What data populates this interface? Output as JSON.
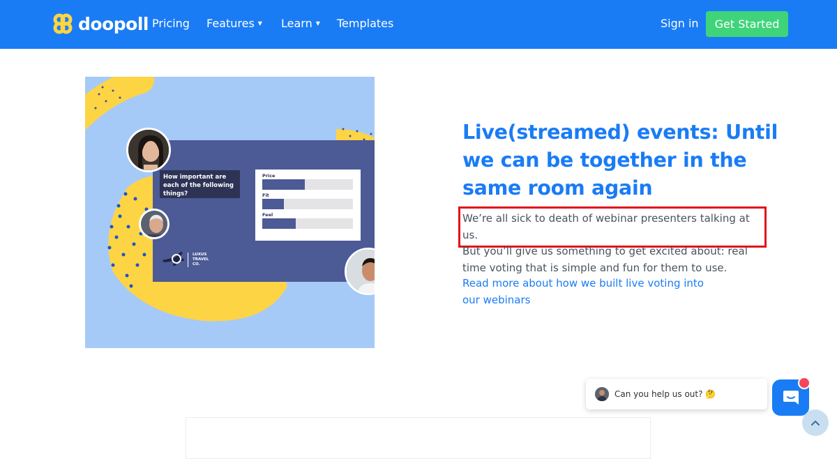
{
  "nav": {
    "logo_text": "doopoll",
    "items": [
      {
        "label": "Pricing",
        "caret": false
      },
      {
        "label": "Features",
        "caret": true
      },
      {
        "label": "Learn",
        "caret": true
      },
      {
        "label": "Templates",
        "caret": false
      }
    ],
    "sign_in": "Sign in",
    "get_started": "Get Started"
  },
  "hero_image": {
    "question": "How important are each of the following things?",
    "poll": [
      {
        "label": "Price",
        "value": 0.47
      },
      {
        "label": "Fit",
        "value": 0.24
      },
      {
        "label": "Feel",
        "value": 0.37
      }
    ],
    "brand_lines": [
      "LUXUS",
      "TRAVEL",
      "CO."
    ]
  },
  "content": {
    "headline": "Live(streamed) events: Until we can be together in the same room again",
    "para_line1": "We’re all sick to death of webinar presenters talking at us.",
    "para_rest": "But you’ll give us something to get excited about: real time voting that is simple and fun for them to use.",
    "read_more": "Read more about how we built live voting into our webinars"
  },
  "chat": {
    "message": "Can you help us out? 🤔"
  },
  "colors": {
    "primary": "#1a7cf5",
    "cta_green": "#3fd47a",
    "highlight_red": "#e0121a",
    "hero_bg": "#a6caf7",
    "slide_bg": "#4c5a95",
    "yellow": "#fdd444"
  }
}
